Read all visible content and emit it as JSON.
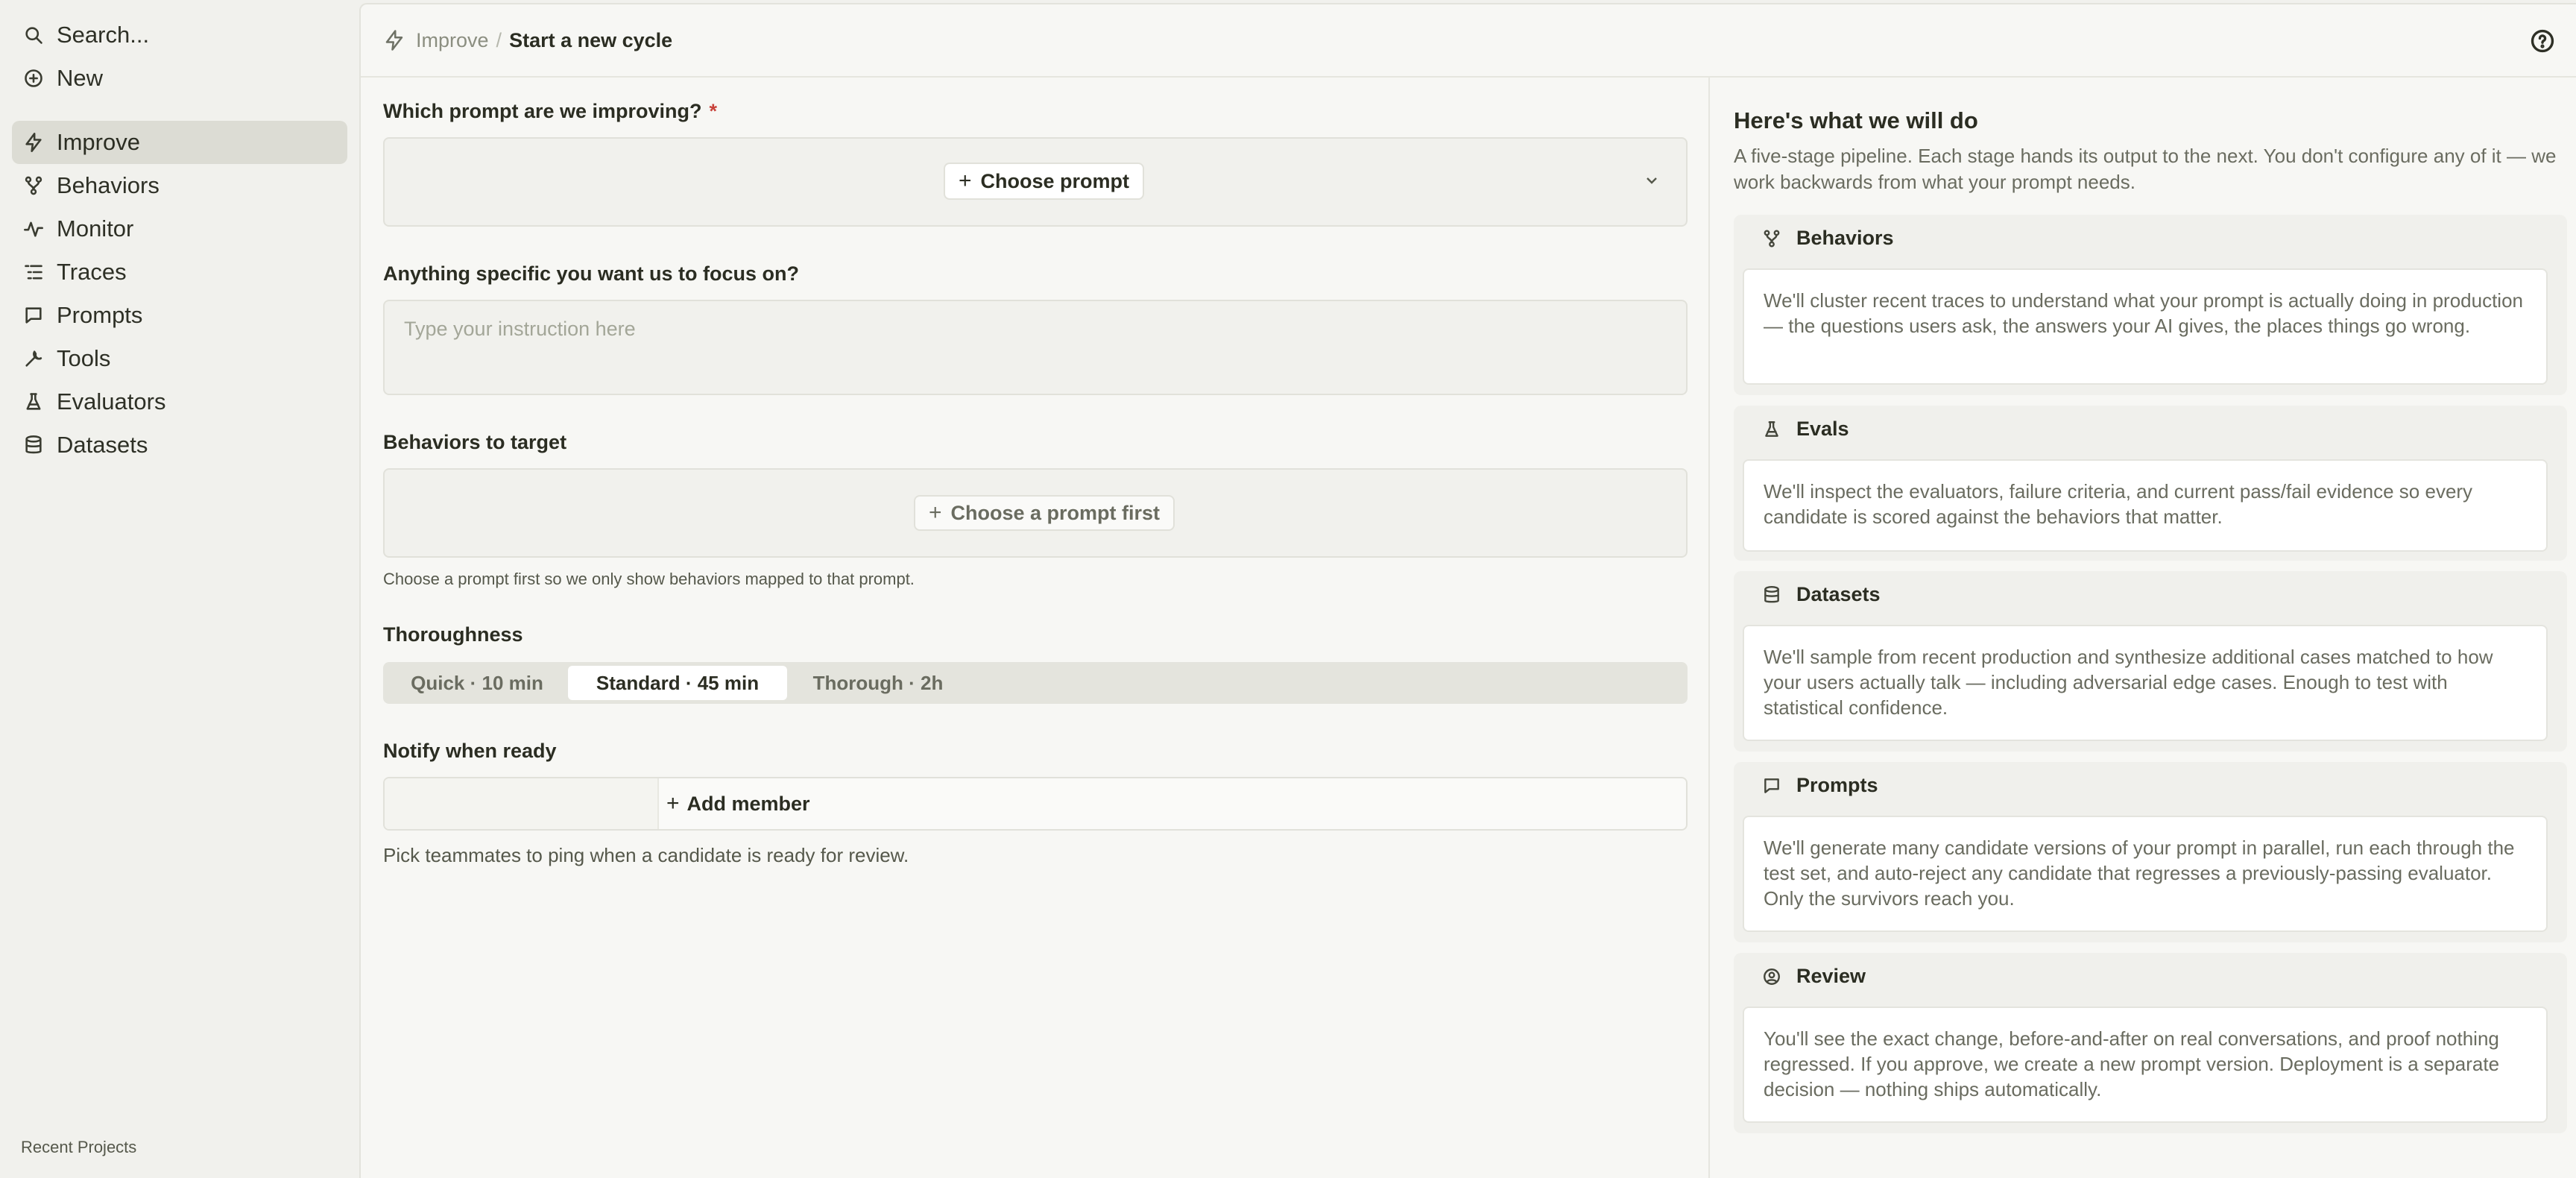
{
  "sidebar": {
    "search_label": "Search...",
    "new_label": "New",
    "items": [
      {
        "label": "Improve",
        "icon": "bolt-icon",
        "active": true
      },
      {
        "label": "Behaviors",
        "icon": "branch-icon"
      },
      {
        "label": "Monitor",
        "icon": "activity-icon"
      },
      {
        "label": "Traces",
        "icon": "list-icon"
      },
      {
        "label": "Prompts",
        "icon": "message-icon"
      },
      {
        "label": "Tools",
        "icon": "wrench-icon"
      },
      {
        "label": "Evaluators",
        "icon": "flask-icon"
      },
      {
        "label": "Datasets",
        "icon": "database-icon"
      }
    ],
    "recent_label": "Recent Projects"
  },
  "header": {
    "breadcrumb_parent": "Improve",
    "breadcrumb_sep": "/",
    "breadcrumb_current": "Start a new cycle"
  },
  "form": {
    "prompt_label": "Which prompt are we improving?",
    "required_mark": "*",
    "choose_prompt": "Choose prompt",
    "focus_label": "Anything specific you want us to focus on?",
    "focus_placeholder": "Type your instruction here",
    "behaviors_label": "Behaviors to target",
    "behaviors_button": "Choose a prompt first",
    "behaviors_hint": "Choose a prompt first so we only show behaviors mapped to that prompt.",
    "thoroughness_label": "Thoroughness",
    "thoroughness_options": [
      "Quick · 10 min",
      "Standard · 45 min",
      "Thorough · 2h"
    ],
    "thoroughness_selected": "Standard · 45 min",
    "notify_label": "Notify when ready",
    "add_member": "Add member",
    "notify_hint": "Pick teammates to ping when a candidate is ready for review."
  },
  "plan": {
    "title": "Here's what we will do",
    "description": "A five-stage pipeline. Each stage hands its output to the next. You don't configure any of it — we work backwards from what your prompt needs.",
    "stages": [
      {
        "name": "Behaviors",
        "icon": "branch-icon",
        "text": "We'll cluster recent traces to understand what your prompt is actually doing in production — the questions users ask, the answers your AI gives, the places things go wrong."
      },
      {
        "name": "Evals",
        "icon": "flask-icon",
        "text": "We'll inspect the evaluators, failure criteria, and current pass/fail evidence so every candidate is scored against the behaviors that matter."
      },
      {
        "name": "Datasets",
        "icon": "database-icon",
        "text": "We'll sample from recent production and synthesize additional cases matched to how your users actually talk — including adversarial edge cases. Enough to test with statistical confidence."
      },
      {
        "name": "Prompts",
        "icon": "message-icon",
        "text": "We'll generate many candidate versions of your prompt in parallel, run each through the test set, and auto-reject any candidate that regresses a previously-passing evaluator. Only the survivors reach you."
      },
      {
        "name": "Review",
        "icon": "user-circle-icon",
        "text": "You'll see the exact change, before-and-after on real conversations, and proof nothing regressed. If you approve, we create a new prompt version. Deployment is a separate decision — nothing ships automatically."
      }
    ]
  }
}
